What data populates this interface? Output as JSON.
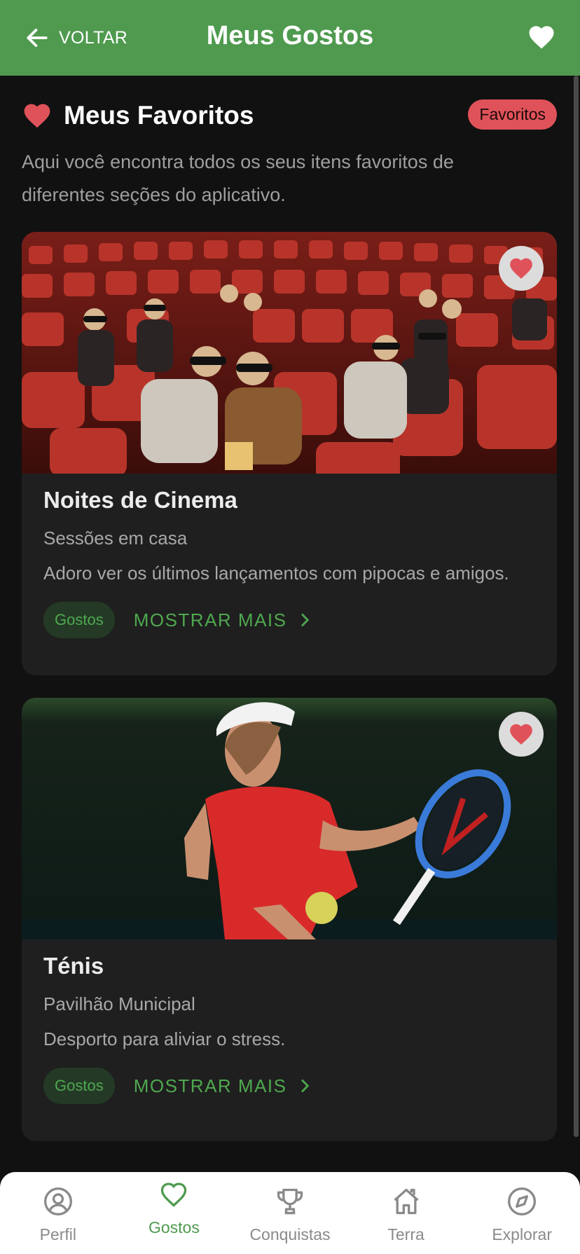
{
  "header": {
    "back_label": "VOLTAR",
    "title": "Meus Gostos"
  },
  "section": {
    "title": "Meus Favoritos",
    "badge": "Favoritos",
    "description": "Aqui você encontra todos os seus itens favoritos de diferentes seções do aplicativo."
  },
  "cards": [
    {
      "title": "Noites de Cinema",
      "subtitle": "Sessões em casa",
      "text": "Adoro ver os últimos lançamentos com pipocas e amigos.",
      "tag": "Gostos",
      "more_label": "MOSTRAR MAIS",
      "image_icon": "cinema-photo"
    },
    {
      "title": "Ténis",
      "subtitle": "Pavilhão Municipal",
      "text": "Desporto para aliviar o stress.",
      "tag": "Gostos",
      "more_label": "MOSTRAR MAIS",
      "image_icon": "tennis-photo"
    }
  ],
  "nav": {
    "items": [
      {
        "label": "Perfil",
        "icon": "person-icon",
        "active": false
      },
      {
        "label": "Gostos",
        "icon": "heart-icon",
        "active": true
      },
      {
        "label": "Conquistas",
        "icon": "trophy-icon",
        "active": false
      },
      {
        "label": "Terra",
        "icon": "home-icon",
        "active": false
      },
      {
        "label": "Explorar",
        "icon": "compass-icon",
        "active": false
      }
    ]
  },
  "colors": {
    "header_bg": "#4f9a4f",
    "accent_green": "#4fa84f",
    "heart_red": "#e0525a",
    "background": "#111111",
    "card_bg": "#1f1f1f"
  }
}
